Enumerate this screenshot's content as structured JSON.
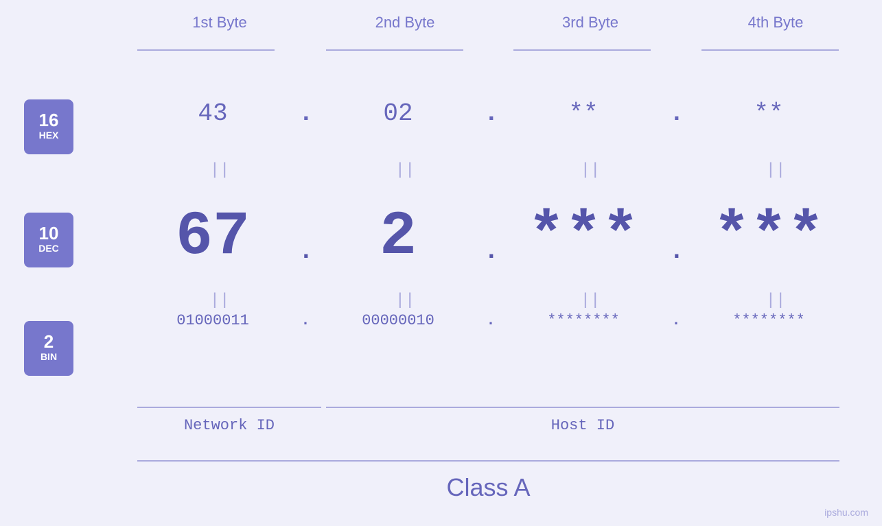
{
  "headers": {
    "byte1": "1st Byte",
    "byte2": "2nd Byte",
    "byte3": "3rd Byte",
    "byte4": "4th Byte"
  },
  "badges": {
    "hex": {
      "number": "16",
      "label": "HEX"
    },
    "dec": {
      "number": "10",
      "label": "DEC"
    },
    "bin": {
      "number": "2",
      "label": "BIN"
    }
  },
  "hex_row": {
    "b1": "43",
    "b2": "02",
    "b3": "**",
    "b4": "**",
    "dot": "."
  },
  "dec_row": {
    "b1": "67",
    "b2": "2",
    "b3": "***",
    "b4": "***",
    "dot": "."
  },
  "bin_row": {
    "b1": "01000011",
    "b2": "00000010",
    "b3": "********",
    "b4": "********",
    "dot": "."
  },
  "equals": "||",
  "labels": {
    "network_id": "Network ID",
    "host_id": "Host ID",
    "class": "Class A"
  },
  "watermark": "ipshu.com"
}
